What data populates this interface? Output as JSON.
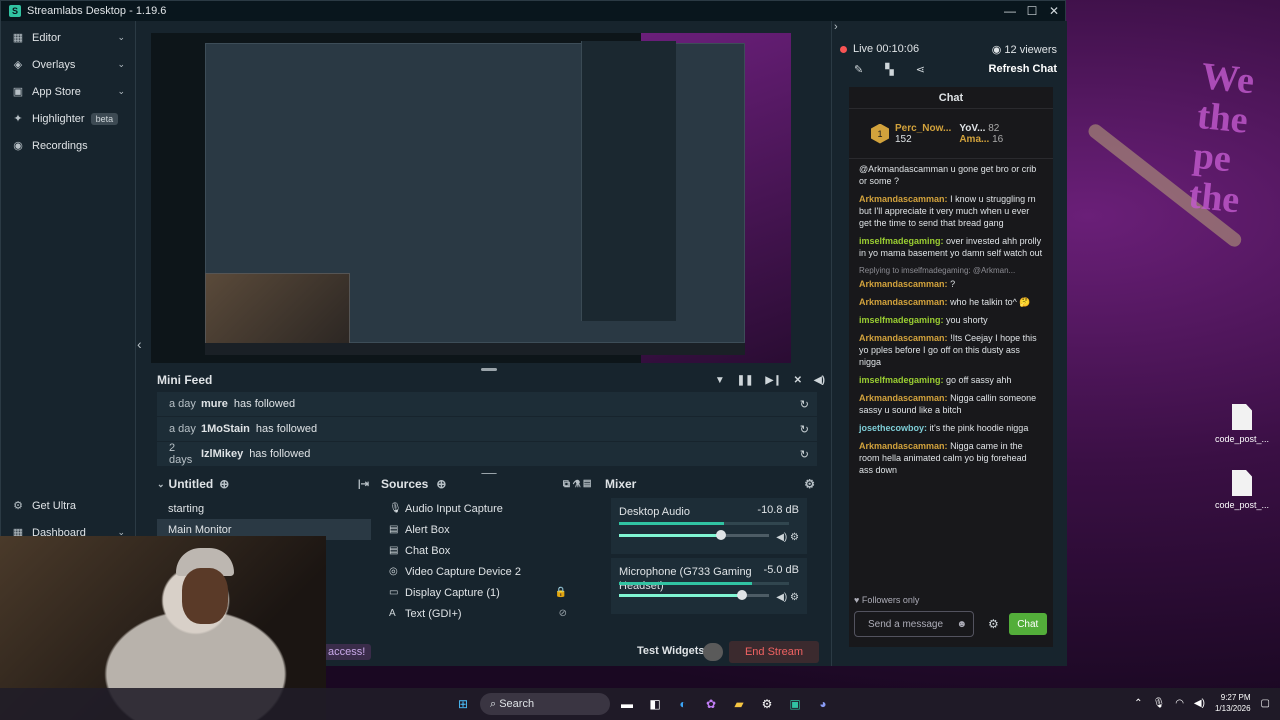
{
  "window": {
    "title": "Streamlabs Desktop - 1.19.6",
    "minimize": "—",
    "maximize": "☐",
    "close": "✕"
  },
  "sidebar": {
    "items": [
      {
        "label": "Editor",
        "icon": "▦"
      },
      {
        "label": "Overlays",
        "icon": "◈"
      },
      {
        "label": "App Store",
        "icon": "▣"
      },
      {
        "label": "Highlighter",
        "icon": "✦",
        "badge": "beta"
      },
      {
        "label": "Recordings",
        "icon": "◉"
      }
    ],
    "bottom": [
      {
        "label": "Get Ultra",
        "icon": "⚙"
      },
      {
        "label": "Dashboard",
        "icon": "▦"
      }
    ]
  },
  "minifeed": {
    "title": "Mini Feed",
    "rows": [
      {
        "when": "a day",
        "who": "mure",
        "action": "has followed"
      },
      {
        "when": "a day",
        "who": "1MoStain",
        "action": "has followed"
      },
      {
        "when": "2 days",
        "who": "IzlMikey",
        "action": "has followed"
      }
    ]
  },
  "scenes": {
    "title": "Untitled",
    "items": [
      "starting",
      "Main Monitor"
    ]
  },
  "sources": {
    "title": "Sources",
    "items": [
      {
        "label": "Audio Input Capture",
        "icon": "🎙",
        "flag": ""
      },
      {
        "label": "Alert Box",
        "icon": "▤",
        "flag": ""
      },
      {
        "label": "Chat Box",
        "icon": "▤",
        "flag": ""
      },
      {
        "label": "Video Capture Device 2",
        "icon": "◎",
        "flag": ""
      },
      {
        "label": "Display Capture (1)",
        "icon": "▭",
        "flag": "🔒"
      },
      {
        "label": "Text (GDI+)",
        "icon": "A",
        "flag": "⊘"
      }
    ]
  },
  "mixer": {
    "title": "Mixer",
    "channels": [
      {
        "name": "Desktop Audio",
        "db": "-10.8 dB",
        "level": 0.62,
        "volume": 0.68
      },
      {
        "name": "Microphone (G733 Gaming Headset)",
        "db": "-5.0 dB",
        "level": 0.78,
        "volume": 0.82
      }
    ]
  },
  "footer": {
    "access": "access!",
    "test_widgets": "Test Widgets",
    "end_stream": "End Stream"
  },
  "stream": {
    "status": "Live",
    "time": "00:10:06",
    "viewers": "12 viewers",
    "refresh_chat": "Refresh Chat"
  },
  "chat": {
    "title": "Chat",
    "leaderboard": {
      "first": "Perc_Now...",
      "first_count": "152",
      "second": "YoV...",
      "second_count": "82",
      "third": "Ama...",
      "third_count": "16"
    },
    "messages": [
      {
        "user": "",
        "color": "gold",
        "text": "@Arkmandascamman u gone get bro or crib or some ?"
      },
      {
        "user": "Arkmandascamman:",
        "color": "gold",
        "text": "I know u struggling rn but I'll appreciate it very much when u ever get the time to send that bread gang"
      },
      {
        "user": "imselfmadegaming:",
        "color": "green",
        "text": "over invested ahh prolly in yo mama basement yo damn self watch out"
      },
      {
        "user": "Arkmandascamman:",
        "color": "gold",
        "text": "?",
        "reply": "Replying to imselfmadegaming: @Arkman..."
      },
      {
        "user": "Arkmandascamman:",
        "color": "gold",
        "text": "who he talkin to^ 🤔"
      },
      {
        "user": "imselfmadegaming:",
        "color": "green",
        "text": "you shorty"
      },
      {
        "user": "Arkmandascamman:",
        "color": "gold",
        "text": "!Its Ceejay I hope this yo pples before I go off on this dusty ass nigga"
      },
      {
        "user": "imselfmadegaming:",
        "color": "green",
        "text": "go off sassy ahh"
      },
      {
        "user": "Arkmandascamman:",
        "color": "gold",
        "text": "Nigga callin someone sassy u sound like a bitch"
      },
      {
        "user": "josethecowboy:",
        "color": "teal",
        "text": "it's the pink hoodie nigga"
      },
      {
        "user": "Arkmandascamman:",
        "color": "gold",
        "text": "Nigga came in the room hella animated calm yo big forehead ass down"
      }
    ],
    "followers_only": "Followers only",
    "placeholder": "Send a message",
    "send_label": "Chat"
  },
  "desktop": {
    "icons": [
      "code_post_...",
      "code_post_..."
    ],
    "wall_text": "We the pe the"
  },
  "taskbar": {
    "search": "Search",
    "time": "9:27 PM",
    "date": "1/13/2026"
  }
}
